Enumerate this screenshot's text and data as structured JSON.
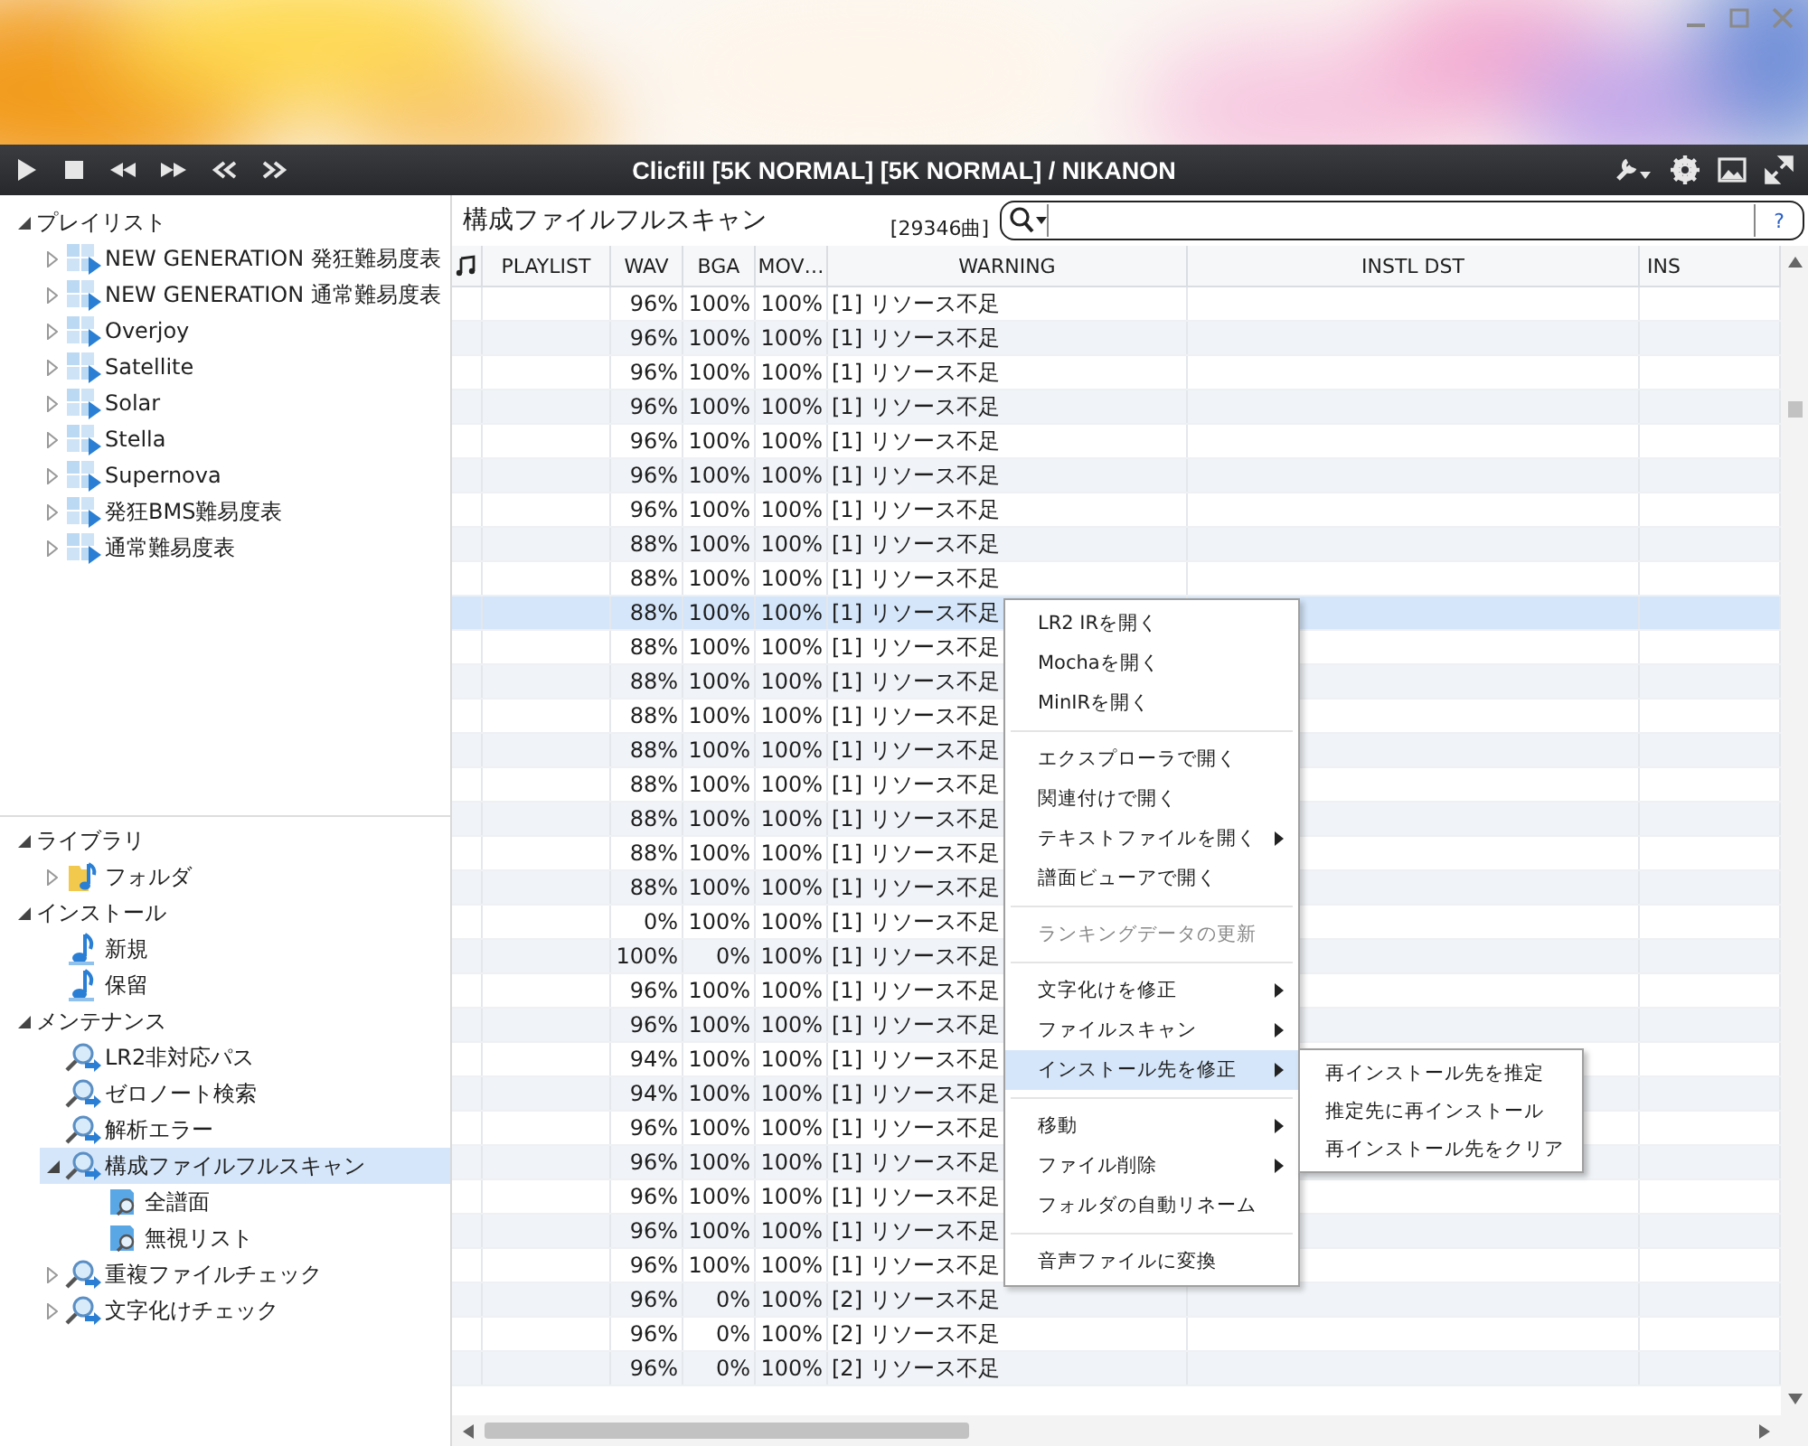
{
  "window": {
    "title": "Clicfill [5K NORMAL] [5K NORMAL] / NIKANON"
  },
  "sidebar": {
    "top_tree": [
      {
        "label": "プレイリスト",
        "expanded": true,
        "selected": false,
        "children": [
          {
            "label": "NEW GENERATION 発狂難易度表",
            "kind": "playlist",
            "expanded": false,
            "selected": false
          },
          {
            "label": "NEW GENERATION 通常難易度表",
            "kind": "playlist",
            "expanded": false,
            "selected": false
          },
          {
            "label": "Overjoy",
            "kind": "playlist",
            "expanded": false,
            "selected": false
          },
          {
            "label": "Satellite",
            "kind": "playlist",
            "expanded": false,
            "selected": false
          },
          {
            "label": "Solar",
            "kind": "playlist",
            "expanded": false,
            "selected": false
          },
          {
            "label": "Stella",
            "kind": "playlist",
            "expanded": false,
            "selected": false
          },
          {
            "label": "Supernova",
            "kind": "playlist",
            "expanded": false,
            "selected": false
          },
          {
            "label": "発狂BMS難易度表",
            "kind": "playlist",
            "expanded": false,
            "selected": false
          },
          {
            "label": "通常難易度表",
            "kind": "playlist",
            "expanded": false,
            "selected": false
          }
        ]
      }
    ],
    "bottom_tree": [
      {
        "label": "ライブラリ",
        "expanded": true,
        "selected": false,
        "children": [
          {
            "label": "フォルダ",
            "kind": "folder",
            "expanded": false,
            "selected": false
          }
        ]
      },
      {
        "label": "インストール",
        "expanded": true,
        "selected": false,
        "children": [
          {
            "label": "新規",
            "kind": "note",
            "selected": false
          },
          {
            "label": "保留",
            "kind": "note",
            "selected": false
          }
        ]
      },
      {
        "label": "メンテナンス",
        "expanded": true,
        "selected": false,
        "children": [
          {
            "label": "LR2非対応パス",
            "kind": "scan",
            "selected": false
          },
          {
            "label": "ゼロノート検索",
            "kind": "scan",
            "selected": false
          },
          {
            "label": "解析エラー",
            "kind": "scan",
            "selected": false
          },
          {
            "label": "構成ファイルフルスキャン",
            "kind": "scan",
            "expanded": true,
            "selected": true,
            "children": [
              {
                "label": "全譜面",
                "kind": "list",
                "selected": false
              },
              {
                "label": "無視リスト",
                "kind": "list",
                "selected": false
              }
            ]
          },
          {
            "label": "重複ファイルチェック",
            "kind": "scan",
            "expanded": false,
            "selected": false
          },
          {
            "label": "文字化けチェック",
            "kind": "scan",
            "expanded": false,
            "selected": false
          }
        ]
      }
    ]
  },
  "panel": {
    "title": "構成ファイルフルスキャン",
    "count": "[29346曲]",
    "search": {
      "help": "?"
    }
  },
  "table": {
    "columns": [
      "PLAYLIST",
      "WAV",
      "BGA",
      "MOV…",
      "WARNING",
      "INSTL DST",
      "INS"
    ],
    "rows": [
      {
        "wav": "96%",
        "bga": "100%",
        "mov": "100%",
        "warning": "[1] リソース不足",
        "selected": false
      },
      {
        "wav": "96%",
        "bga": "100%",
        "mov": "100%",
        "warning": "[1] リソース不足",
        "selected": false
      },
      {
        "wav": "96%",
        "bga": "100%",
        "mov": "100%",
        "warning": "[1] リソース不足",
        "selected": false
      },
      {
        "wav": "96%",
        "bga": "100%",
        "mov": "100%",
        "warning": "[1] リソース不足",
        "selected": false
      },
      {
        "wav": "96%",
        "bga": "100%",
        "mov": "100%",
        "warning": "[1] リソース不足",
        "selected": false
      },
      {
        "wav": "96%",
        "bga": "100%",
        "mov": "100%",
        "warning": "[1] リソース不足",
        "selected": false
      },
      {
        "wav": "96%",
        "bga": "100%",
        "mov": "100%",
        "warning": "[1] リソース不足",
        "selected": false
      },
      {
        "wav": "88%",
        "bga": "100%",
        "mov": "100%",
        "warning": "[1] リソース不足",
        "selected": false
      },
      {
        "wav": "88%",
        "bga": "100%",
        "mov": "100%",
        "warning": "[1] リソース不足",
        "selected": false
      },
      {
        "wav": "88%",
        "bga": "100%",
        "mov": "100%",
        "warning": "[1] リソース不足",
        "selected": true
      },
      {
        "wav": "88%",
        "bga": "100%",
        "mov": "100%",
        "warning": "[1] リソース不足",
        "selected": false
      },
      {
        "wav": "88%",
        "bga": "100%",
        "mov": "100%",
        "warning": "[1] リソース不足",
        "selected": false
      },
      {
        "wav": "88%",
        "bga": "100%",
        "mov": "100%",
        "warning": "[1] リソース不足",
        "selected": false
      },
      {
        "wav": "88%",
        "bga": "100%",
        "mov": "100%",
        "warning": "[1] リソース不足",
        "selected": false
      },
      {
        "wav": "88%",
        "bga": "100%",
        "mov": "100%",
        "warning": "[1] リソース不足",
        "selected": false
      },
      {
        "wav": "88%",
        "bga": "100%",
        "mov": "100%",
        "warning": "[1] リソース不足",
        "selected": false
      },
      {
        "wav": "88%",
        "bga": "100%",
        "mov": "100%",
        "warning": "[1] リソース不足",
        "selected": false
      },
      {
        "wav": "88%",
        "bga": "100%",
        "mov": "100%",
        "warning": "[1] リソース不足",
        "selected": false
      },
      {
        "wav": "0%",
        "bga": "100%",
        "mov": "100%",
        "warning": "[1] リソース不足",
        "selected": false
      },
      {
        "wav": "100%",
        "bga": "0%",
        "mov": "100%",
        "warning": "[1] リソース不足",
        "selected": false
      },
      {
        "wav": "96%",
        "bga": "100%",
        "mov": "100%",
        "warning": "[1] リソース不足",
        "selected": false
      },
      {
        "wav": "96%",
        "bga": "100%",
        "mov": "100%",
        "warning": "[1] リソース不足",
        "selected": false
      },
      {
        "wav": "94%",
        "bga": "100%",
        "mov": "100%",
        "warning": "[1] リソース不足",
        "selected": false
      },
      {
        "wav": "94%",
        "bga": "100%",
        "mov": "100%",
        "warning": "[1] リソース不足",
        "selected": false
      },
      {
        "wav": "96%",
        "bga": "100%",
        "mov": "100%",
        "warning": "[1] リソース不足",
        "selected": false
      },
      {
        "wav": "96%",
        "bga": "100%",
        "mov": "100%",
        "warning": "[1] リソース不足",
        "selected": false
      },
      {
        "wav": "96%",
        "bga": "100%",
        "mov": "100%",
        "warning": "[1] リソース不足",
        "selected": false
      },
      {
        "wav": "96%",
        "bga": "100%",
        "mov": "100%",
        "warning": "[1] リソース不足",
        "selected": false
      },
      {
        "wav": "96%",
        "bga": "100%",
        "mov": "100%",
        "warning": "[1] リソース不足",
        "selected": false
      },
      {
        "wav": "96%",
        "bga": "0%",
        "mov": "100%",
        "warning": "[2] リソース不足",
        "selected": false
      },
      {
        "wav": "96%",
        "bga": "0%",
        "mov": "100%",
        "warning": "[2] リソース不足",
        "selected": false
      },
      {
        "wav": "96%",
        "bga": "0%",
        "mov": "100%",
        "warning": "[2] リソース不足",
        "selected": false
      }
    ]
  },
  "context_menu": {
    "items": [
      {
        "kind": "item",
        "label": "LR2 IRを開く",
        "disabled": false,
        "submenu": false,
        "selected": false
      },
      {
        "kind": "item",
        "label": "Mochaを開く",
        "disabled": false,
        "submenu": false,
        "selected": false
      },
      {
        "kind": "item",
        "label": "MinIRを開く",
        "disabled": false,
        "submenu": false,
        "selected": false
      },
      {
        "kind": "separator"
      },
      {
        "kind": "item",
        "label": "エクスプローラで開く",
        "disabled": false,
        "submenu": false,
        "selected": false
      },
      {
        "kind": "item",
        "label": "関連付けで開く",
        "disabled": false,
        "submenu": false,
        "selected": false
      },
      {
        "kind": "item",
        "label": "テキストファイルを開く",
        "disabled": false,
        "submenu": true,
        "selected": false
      },
      {
        "kind": "item",
        "label": "譜面ビューアで開く",
        "disabled": false,
        "submenu": false,
        "selected": false
      },
      {
        "kind": "separator"
      },
      {
        "kind": "item",
        "label": "ランキングデータの更新",
        "disabled": true,
        "submenu": false,
        "selected": false
      },
      {
        "kind": "separator"
      },
      {
        "kind": "item",
        "label": "文字化けを修正",
        "disabled": false,
        "submenu": true,
        "selected": false
      },
      {
        "kind": "item",
        "label": "ファイルスキャン",
        "disabled": false,
        "submenu": true,
        "selected": false
      },
      {
        "kind": "item",
        "label": "インストール先を修正",
        "disabled": false,
        "submenu": true,
        "selected": true
      },
      {
        "kind": "separator"
      },
      {
        "kind": "item",
        "label": "移動",
        "disabled": false,
        "submenu": true,
        "selected": false
      },
      {
        "kind": "item",
        "label": "ファイル削除",
        "disabled": false,
        "submenu": true,
        "selected": false
      },
      {
        "kind": "item",
        "label": "フォルダの自動リネーム",
        "disabled": false,
        "submenu": false,
        "selected": false
      },
      {
        "kind": "separator"
      },
      {
        "kind": "item",
        "label": "音声ファイルに変換",
        "disabled": false,
        "submenu": false,
        "selected": false
      }
    ],
    "submenu": [
      "再インストール先を推定",
      "推定先に再インストール",
      "再インストール先をクリア"
    ]
  }
}
